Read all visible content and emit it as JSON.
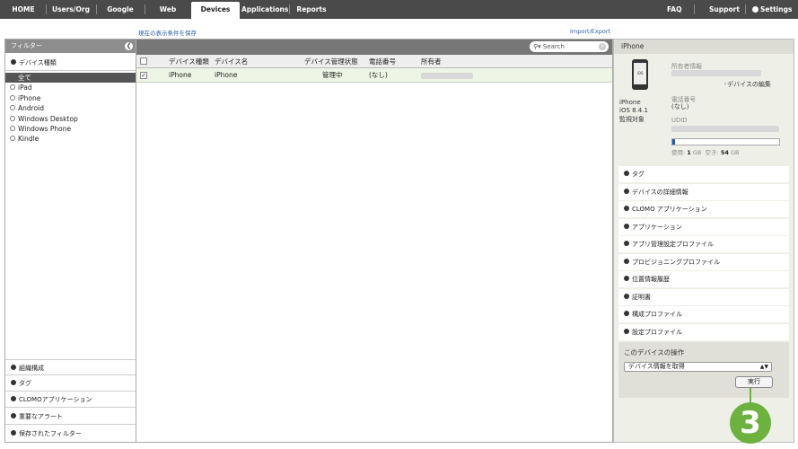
{
  "nav": {
    "tabs": [
      "HOME",
      "Users/Org",
      "Google Apps",
      "Web Access",
      "Devices",
      "Applications",
      "Reports"
    ],
    "active": "Devices",
    "right": [
      "FAQ",
      "Support",
      "Settings"
    ]
  },
  "links": {
    "save_view": "現在の表示条件を保存",
    "import_export": "Import/Export"
  },
  "sidebar": {
    "title": "フィルター",
    "device_type_section": "デバイス種類",
    "items": [
      "全て",
      "iPad",
      "iPhone",
      "Android",
      "Windows Desktop",
      "Windows Phone",
      "Kindle"
    ],
    "bottom_sections": [
      "組織構成",
      "タグ",
      "CLOMOアプリケーション",
      "重要なアラート",
      "保存されたフィルター"
    ]
  },
  "list": {
    "search_placeholder": "Search",
    "columns": [
      "デバイス種類",
      "デバイス名",
      "デバイス管理状態",
      "電話番号",
      "所有者"
    ],
    "rows": [
      {
        "type": "iPhone",
        "name": "iPhone",
        "status": "管理中",
        "phone": "(なし)"
      }
    ]
  },
  "detail": {
    "header": "iPhone",
    "device_name": "iPhone",
    "os": "iOS 8.4.1",
    "supervised": "監視対象",
    "owner_label": "所有者情報",
    "edit_link": "デバイスの編集",
    "phone_label": "電話番号",
    "phone_value": "(なし)",
    "udid_label": "UDID",
    "used_label": "使用:",
    "used_value": "1",
    "free_label": "空き:",
    "free_value": "54",
    "unit": "GB",
    "storage_used_fraction": 0.02,
    "sections": [
      "タグ",
      "デバイスの詳細情報",
      "CLOMO アプリケーション",
      "アプリケーション",
      "アプリ管理設定プロファイル",
      "プロビジョニングプロファイル",
      "位置情報履歴",
      "証明書",
      "構成プロファイル",
      "設定プロファイル"
    ],
    "operation_title": "このデバイスの操作",
    "operation_selected": "デバイス情報を取得",
    "run_button": "実行"
  },
  "callout": "3",
  "colors": {
    "nav_bg": "#4a4a4a",
    "accent_green": "#6db23f",
    "storage_blue": "#1f5ab3"
  }
}
